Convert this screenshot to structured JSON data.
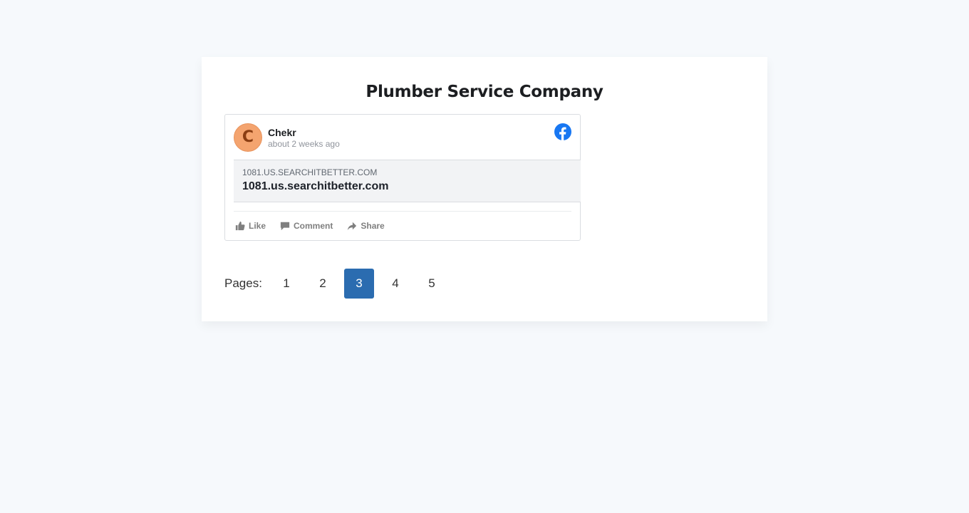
{
  "page": {
    "title": "Plumber Service Company"
  },
  "post": {
    "avatar_letter": "C",
    "author": "Chekr",
    "time": "about 2 weeks ago",
    "link": {
      "domain": "1081.US.SEARCHITBETTER.COM",
      "title": "1081.us.searchitbetter.com"
    },
    "actions": {
      "like": "Like",
      "comment": "Comment",
      "share": "Share"
    },
    "network_icon": "facebook-icon"
  },
  "pagination": {
    "label": "Pages:",
    "pages": [
      "1",
      "2",
      "3",
      "4",
      "5"
    ],
    "current": "3"
  },
  "colors": {
    "background": "#f6f9fc",
    "active_page": "#2b6cb0",
    "facebook": "#1877f2",
    "avatar": "#f4a46f"
  }
}
